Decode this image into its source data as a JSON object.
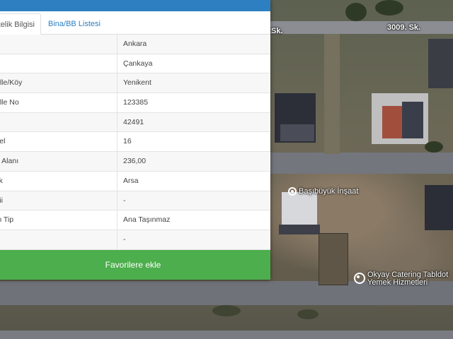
{
  "panel": {
    "tabs": [
      {
        "label": "Nitelik Bilgisi",
        "active": true
      },
      {
        "label": "Bina/BB Listesi",
        "active": false
      }
    ],
    "rows": [
      {
        "key": "",
        "value": "Ankara"
      },
      {
        "key": "",
        "value": "Çankaya"
      },
      {
        "key": "alle/Köy",
        "value": "Yenikent"
      },
      {
        "key": "alle No",
        "value": "123385"
      },
      {
        "key": "",
        "value": "42491"
      },
      {
        "key": "sel",
        "value": "16"
      },
      {
        "key": "u Alanı",
        "value": "236,00"
      },
      {
        "key": "lik",
        "value": "Arsa"
      },
      {
        "key": "kii",
        "value": "-"
      },
      {
        "key": "in Tip",
        "value": "Ana Taşınmaz"
      },
      {
        "key": "a",
        "value": "-"
      }
    ],
    "favorite_button": "Favorilere ekle",
    "colors": {
      "header": "#2e7fc1",
      "button": "#4cae4c"
    }
  },
  "map": {
    "road_labels": [
      "Sk.",
      "3009. Sk."
    ],
    "pins": [
      {
        "label": "Başıbüyük İnşaat",
        "icon": "location-pin-icon"
      },
      {
        "label": "Okyay Catering Tabldot\nYemek Hizmetleri",
        "icon": "location-pin-icon"
      }
    ]
  }
}
